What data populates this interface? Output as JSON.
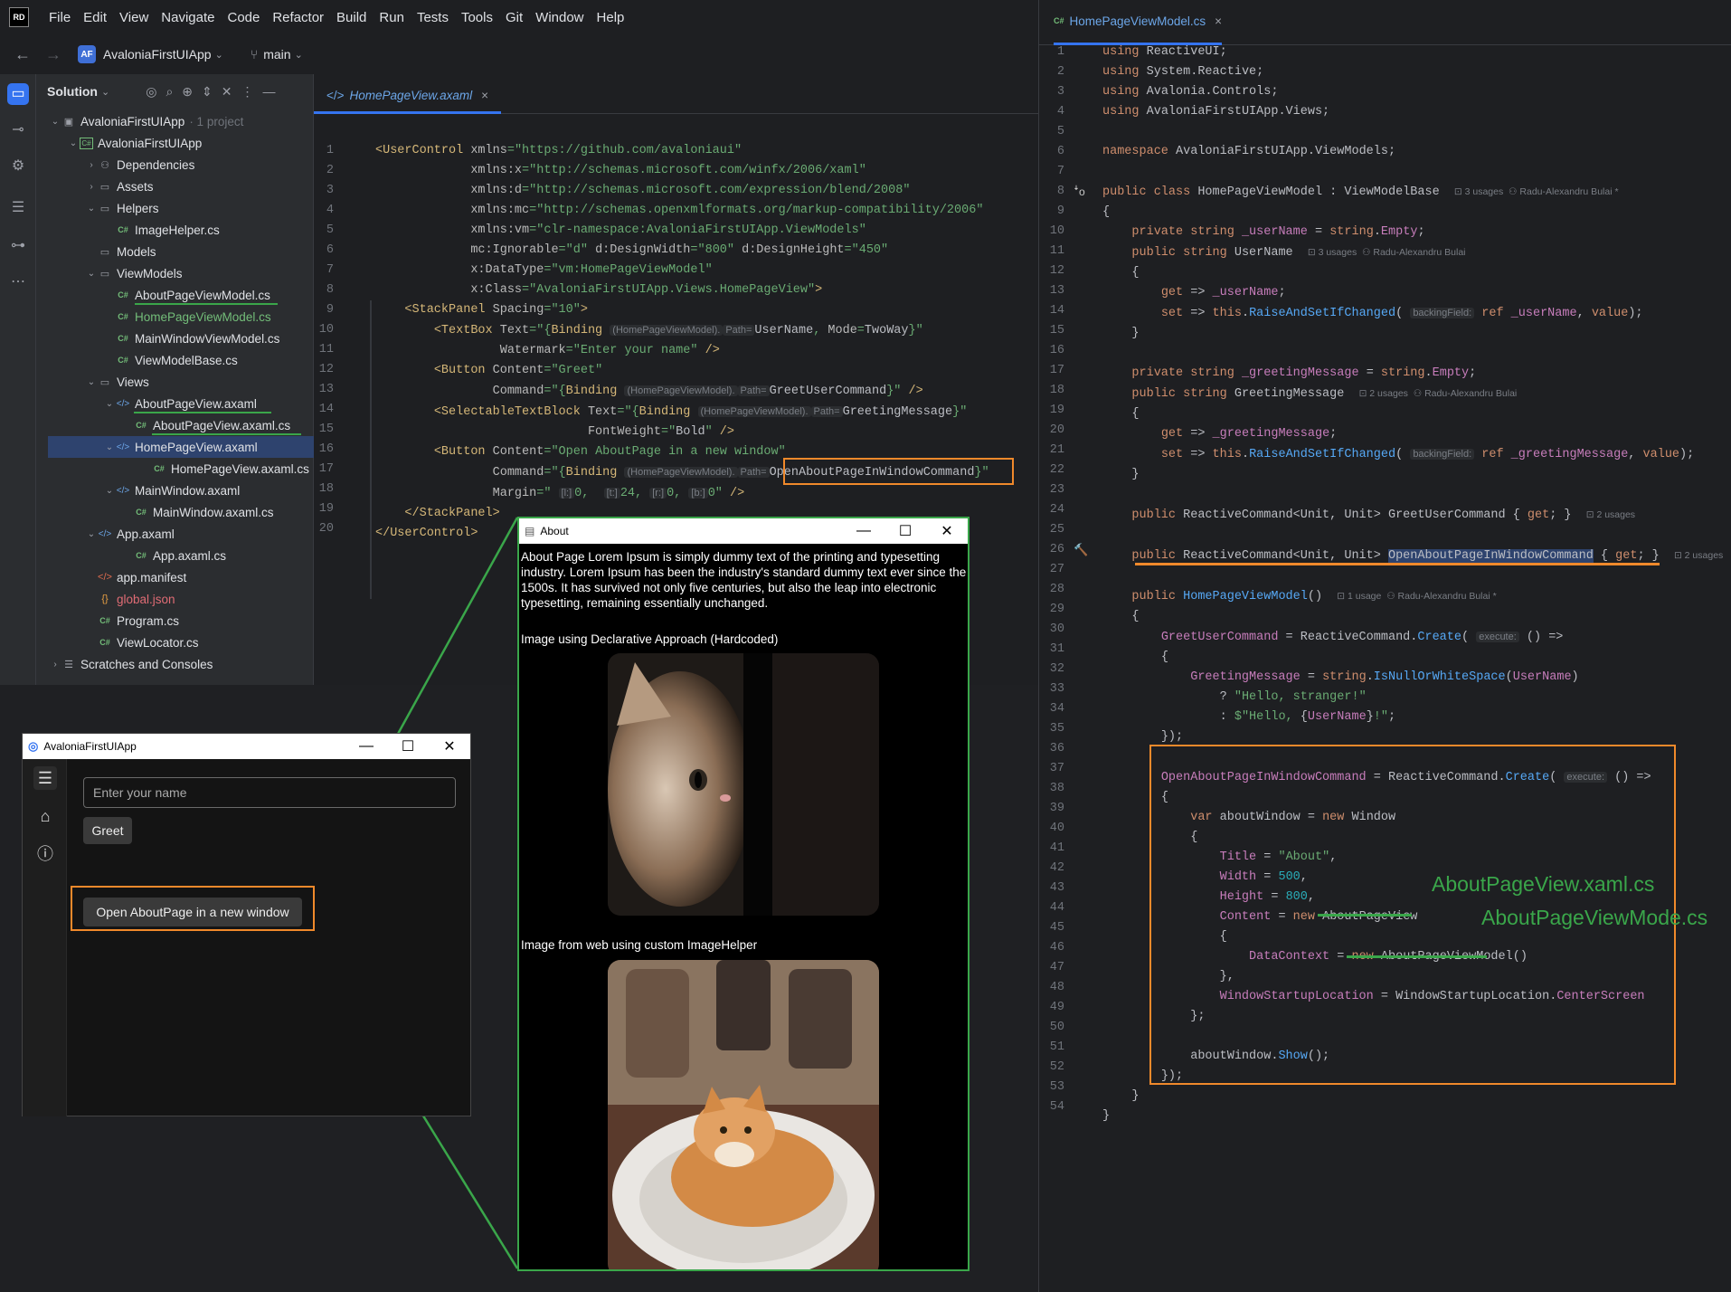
{
  "menu": {
    "logo": "RD",
    "items": [
      "File",
      "Edit",
      "View",
      "Navigate",
      "Code",
      "Refactor",
      "Build",
      "Run",
      "Tests",
      "Tools",
      "Git",
      "Window",
      "Help"
    ]
  },
  "toolbar": {
    "project_badge": "AF",
    "project_name": "AvaloniaFirstUIApp",
    "branch": "main"
  },
  "solution_panel": {
    "title": "Solution",
    "tree": [
      {
        "label": "AvaloniaFirstUIApp",
        "suffix": "· 1 project"
      },
      {
        "label": "AvaloniaFirstUIApp"
      },
      {
        "label": "Dependencies"
      },
      {
        "label": "Assets"
      },
      {
        "label": "Helpers"
      },
      {
        "label": "ImageHelper.cs"
      },
      {
        "label": "Models"
      },
      {
        "label": "ViewModels"
      },
      {
        "label": "AboutPageViewModel.cs"
      },
      {
        "label": "HomePageViewModel.cs"
      },
      {
        "label": "MainWindowViewModel.cs"
      },
      {
        "label": "ViewModelBase.cs"
      },
      {
        "label": "Views"
      },
      {
        "label": "AboutPageView.axaml"
      },
      {
        "label": "AboutPageView.axaml.cs"
      },
      {
        "label": "HomePageView.axaml"
      },
      {
        "label": "HomePageView.axaml.cs"
      },
      {
        "label": "MainWindow.axaml"
      },
      {
        "label": "MainWindow.axaml.cs"
      },
      {
        "label": "App.axaml"
      },
      {
        "label": "App.axaml.cs"
      },
      {
        "label": "app.manifest"
      },
      {
        "label": "global.json"
      },
      {
        "label": "Program.cs"
      },
      {
        "label": "ViewLocator.cs"
      },
      {
        "label": "Scratches and Consoles"
      }
    ]
  },
  "left_editor": {
    "tab": "HomePageView.axaml"
  },
  "right_editor": {
    "tab": "HomePageViewModel.cs",
    "usages": {
      "u3": "3 usages",
      "u2": "2 usages",
      "u1": "1 usage",
      "author": "Radu-Alexandru Bulai",
      "author_star": "Radu-Alexandru Bulai *"
    },
    "hints": {
      "backing": "backingField:",
      "execute": "execute:"
    },
    "annotation_1": "AboutPageView.xaml.cs",
    "annotation_2": "AboutPageViewMode.cs"
  },
  "app_window": {
    "title": "AvaloniaFirstUIApp",
    "name_placeholder": "Enter your name",
    "greet_label": "Greet",
    "open_label": "Open AboutPage in a new window"
  },
  "about_window": {
    "title": "About",
    "body": "About Page Lorem Ipsum is simply dummy text of the printing and typesetting industry. Lorem Ipsum has been the industry's standard dummy text ever since the 1500s. It has survived not only five centuries, but also the leap into electronic typesetting, remaining essentially unchanged.",
    "caption1": "Image using Declarative Approach (Hardcoded)",
    "caption2": "Image from web using custom ImageHelper"
  },
  "colors": {
    "accent": "#3574f0",
    "highlight_orange": "#f0892b",
    "highlight_green": "#3aa64a"
  }
}
